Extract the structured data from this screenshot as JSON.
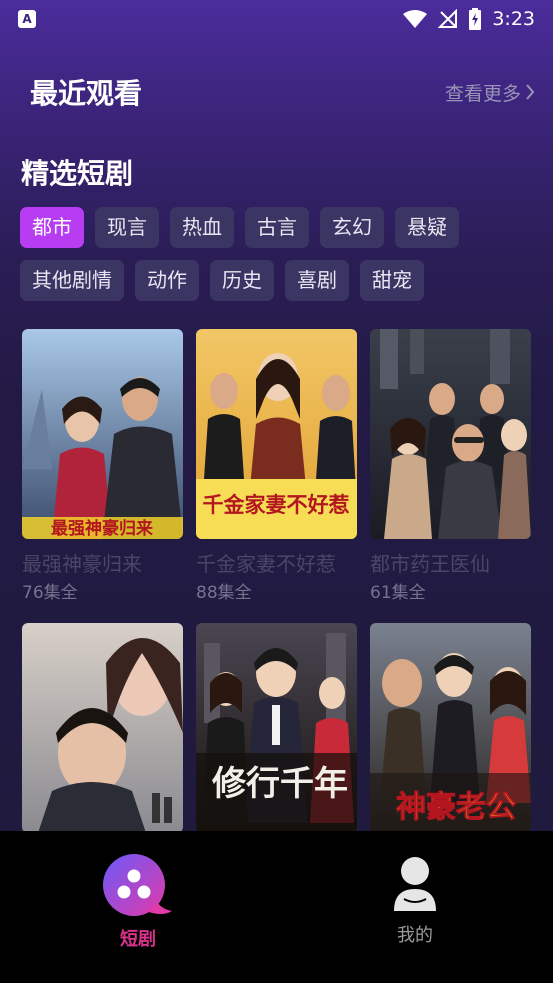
{
  "status_bar": {
    "notification_icon": "app-notification-icon",
    "time": "3:23",
    "icons": [
      "wifi-icon",
      "no-signal-icon",
      "battery-charging-icon"
    ]
  },
  "recent": {
    "title": "最近观看",
    "see_more": "查看更多"
  },
  "featured": {
    "title": "精选短剧",
    "categories_row1": [
      "都市",
      "现言",
      "热血",
      "古言",
      "玄幻",
      "悬疑"
    ],
    "categories_row2": [
      "其他剧情",
      "动作",
      "历史",
      "喜剧",
      "甜宠"
    ],
    "active_category": "都市"
  },
  "dramas": [
    {
      "title": "最强神豪归来",
      "episodes": "76集全",
      "poster_text": "最强神豪归来"
    },
    {
      "title": "千金家妻不好惹",
      "episodes": "88集全",
      "poster_text": "千金家妻不好惹"
    },
    {
      "title": "都市药王医仙",
      "episodes": "61集全",
      "poster_text": ""
    },
    {
      "title": "",
      "episodes": "",
      "poster_text": ""
    },
    {
      "title": "",
      "episodes": "",
      "poster_text": "修行千年"
    },
    {
      "title": "",
      "episodes": "",
      "poster_text": "神豪老公"
    }
  ],
  "bottom_nav": {
    "dramas_label": "短剧",
    "mine_label": "我的"
  },
  "colors": {
    "accent": "#b73cf2",
    "nav_active": "#d9338b",
    "chip_bg": "#3b3563"
  }
}
